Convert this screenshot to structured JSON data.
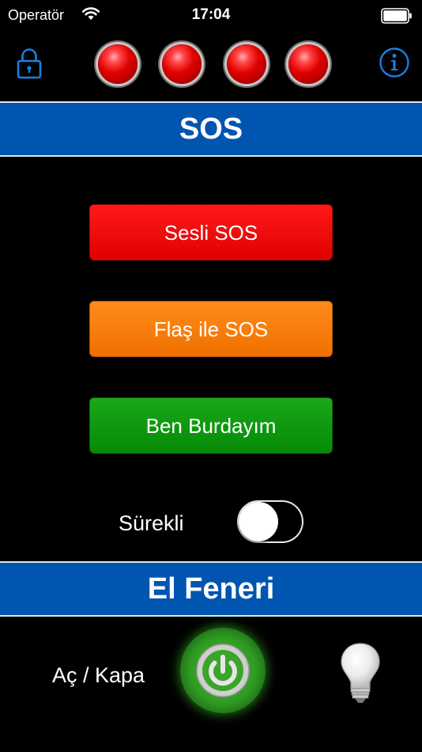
{
  "status_bar": {
    "carrier": "Operatör",
    "time": "17:04",
    "wifi_icon": "wifi-icon",
    "battery_icon": "battery-icon"
  },
  "toolbar": {
    "lock_icon": "lock-icon",
    "info_icon": "info-icon",
    "indicator_lights": [
      "red",
      "red",
      "red",
      "red"
    ],
    "accent_color": "#1a7fe0"
  },
  "sos_section": {
    "title": "SOS",
    "bar_color": "#0055b0"
  },
  "buttons": {
    "sound_sos": {
      "label": "Sesli SOS",
      "color": "#ff1a1a"
    },
    "flash_sos": {
      "label": "Flaş ile SOS",
      "color": "#ff8c1a"
    },
    "im_here": {
      "label": "Ben Burdayım",
      "color": "#1aa81a"
    }
  },
  "continuous": {
    "label": "Sürekli",
    "enabled": false
  },
  "torch_section": {
    "title": "El Feneri"
  },
  "torch": {
    "label": "Aç / Kapa",
    "power_icon": "power-icon",
    "bulb_icon": "light-bulb-icon",
    "power_color": "#2e9a22"
  }
}
